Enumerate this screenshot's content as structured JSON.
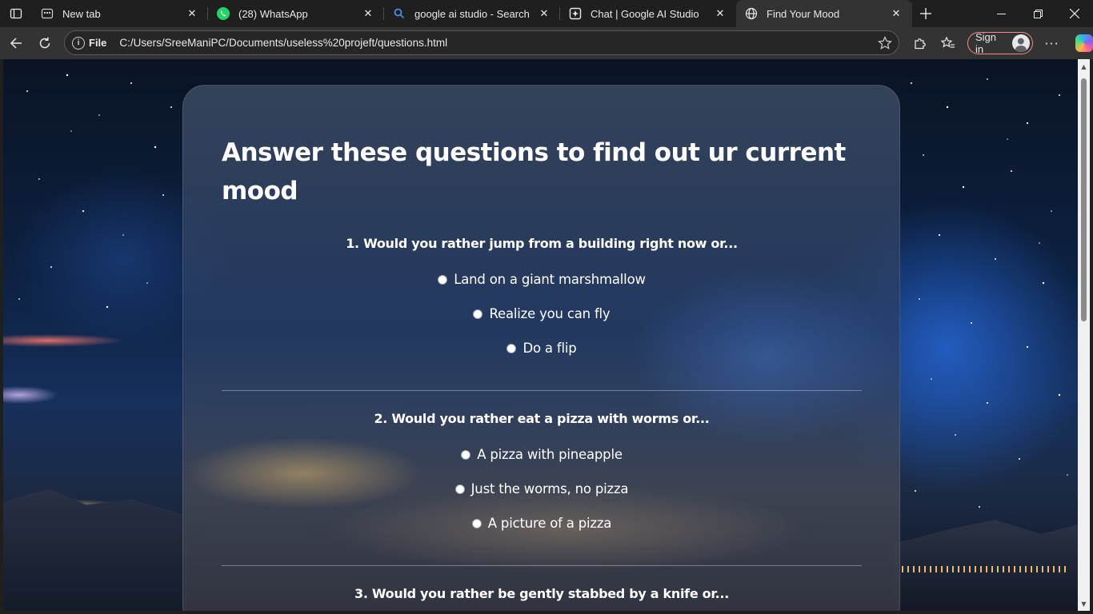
{
  "tabs": [
    {
      "title": "New tab",
      "icon": "newtab-page-icon"
    },
    {
      "title": "(28) WhatsApp",
      "icon": "whatsapp-icon"
    },
    {
      "title": "google ai studio - Search",
      "icon": "search-icon"
    },
    {
      "title": "Chat | Google AI Studio",
      "icon": "ai-studio-icon"
    },
    {
      "title": "Find Your Mood",
      "icon": "globe-icon",
      "active": true
    }
  ],
  "address_bar": {
    "scheme_label": "File",
    "url": "C:/Users/SreeManiPC/Documents/useless%20projeft/questions.html"
  },
  "toolbar": {
    "signin_label": "Sign in"
  },
  "page": {
    "heading": "Answer these questions to find out ur current mood",
    "questions": [
      {
        "title": "1. Would you rather jump from a building right now or...",
        "options": [
          "Land on a giant marshmallow",
          "Realize you can fly",
          "Do a flip"
        ]
      },
      {
        "title": "2. Would you rather eat a pizza with worms or...",
        "options": [
          "A pizza with pineapple",
          "Just the worms, no pizza",
          "A picture of a pizza"
        ]
      },
      {
        "title": "3. Would you rather be gently stabbed by a knife or...",
        "options": []
      }
    ]
  },
  "colors": {
    "accent_signin_border": "#f28b82",
    "card_text": "#ffffff",
    "browser_chrome": "#1f1f1f"
  }
}
